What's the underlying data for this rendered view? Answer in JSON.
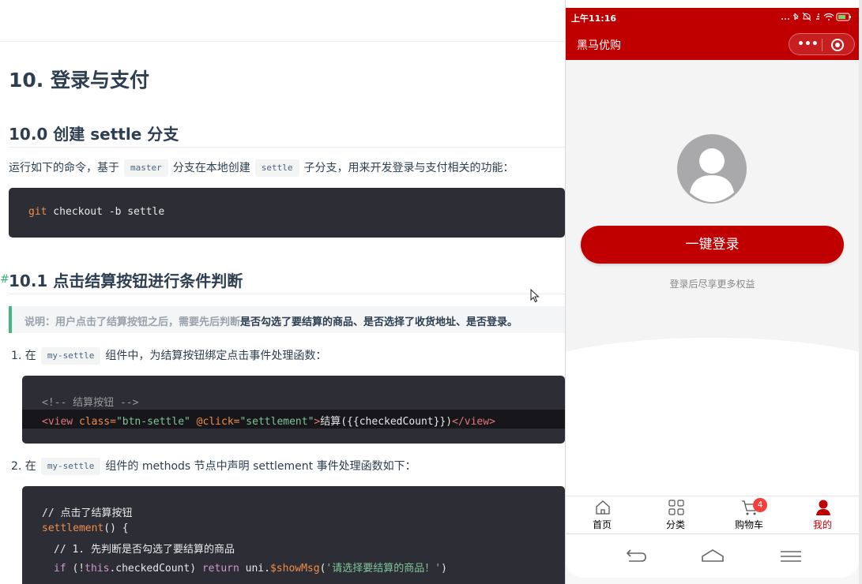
{
  "doc": {
    "h2": "10. 登录与支付",
    "h3a": "10.0 创建 settle 分支",
    "para": {
      "before": "运行如下的命令，基于",
      "code_master": "master",
      "middle": "分支在本地创建",
      "code_settle": "settle",
      "after": "子分支，用来开发登录与支付相关的功能："
    },
    "code1": {
      "git": "git",
      "rest": " checkout -b settle"
    },
    "hash": "#",
    "h3b": "10.1 点击结算按钮进行条件判断",
    "tip": {
      "muted": "说明：用户点击了结算按钮之后，需要先后判断",
      "strong": "是否勾选了要结算的商品、是否选择了收货地址、是否登录。"
    },
    "step1": {
      "num": "1. 在",
      "code": "my-settle",
      "text": "组件中，为结算按钮绑定点击事件处理函数："
    },
    "code2": {
      "comment": "<!-- 结算按钮 -->",
      "tag_open": "<view",
      "attr_class": " class=",
      "str_class": "\"btn-settle\"",
      "attr_click": " @click=",
      "str_click": "\"settlement\"",
      "gt": ">",
      "content": "结算({{checkedCount}})",
      "tag_close": "</view>"
    },
    "step2": {
      "num": "2. 在",
      "code": "my-settle",
      "text": "组件的 methods 节点中声明 settlement 事件处理函数如下："
    },
    "code3": {
      "line1": "// 点击了结算按钮",
      "line2_fn": "settlement",
      "line2_rest": "() {",
      "line3": "// 1. 先判断是否勾选了要结算的商品",
      "line4_if": "if",
      "line4_a": " (!",
      "line4_this": "this",
      "line4_b": ".checkedCount) ",
      "line4_return": "return",
      "line4_c": " uni.",
      "line4_method": "$showMsg",
      "line4_d": "(",
      "line4_str": "'请选择要结算的商品！'",
      "line4_e": ")"
    }
  },
  "phone": {
    "time": "上午11:16",
    "status_icons": "... ✱ ⊘ ▲ ◉",
    "nav_title": "黑马优购",
    "capsule_more": "•••",
    "login_button": "一键登录",
    "tip": "登录后尽享更多权益",
    "tabs": [
      {
        "label": "首页",
        "icon": "home-icon"
      },
      {
        "label": "分类",
        "icon": "category-icon"
      },
      {
        "label": "购物车",
        "icon": "cart-icon",
        "badge": "4"
      },
      {
        "label": "我的",
        "icon": "user-icon"
      }
    ],
    "accent": "#c00000"
  }
}
